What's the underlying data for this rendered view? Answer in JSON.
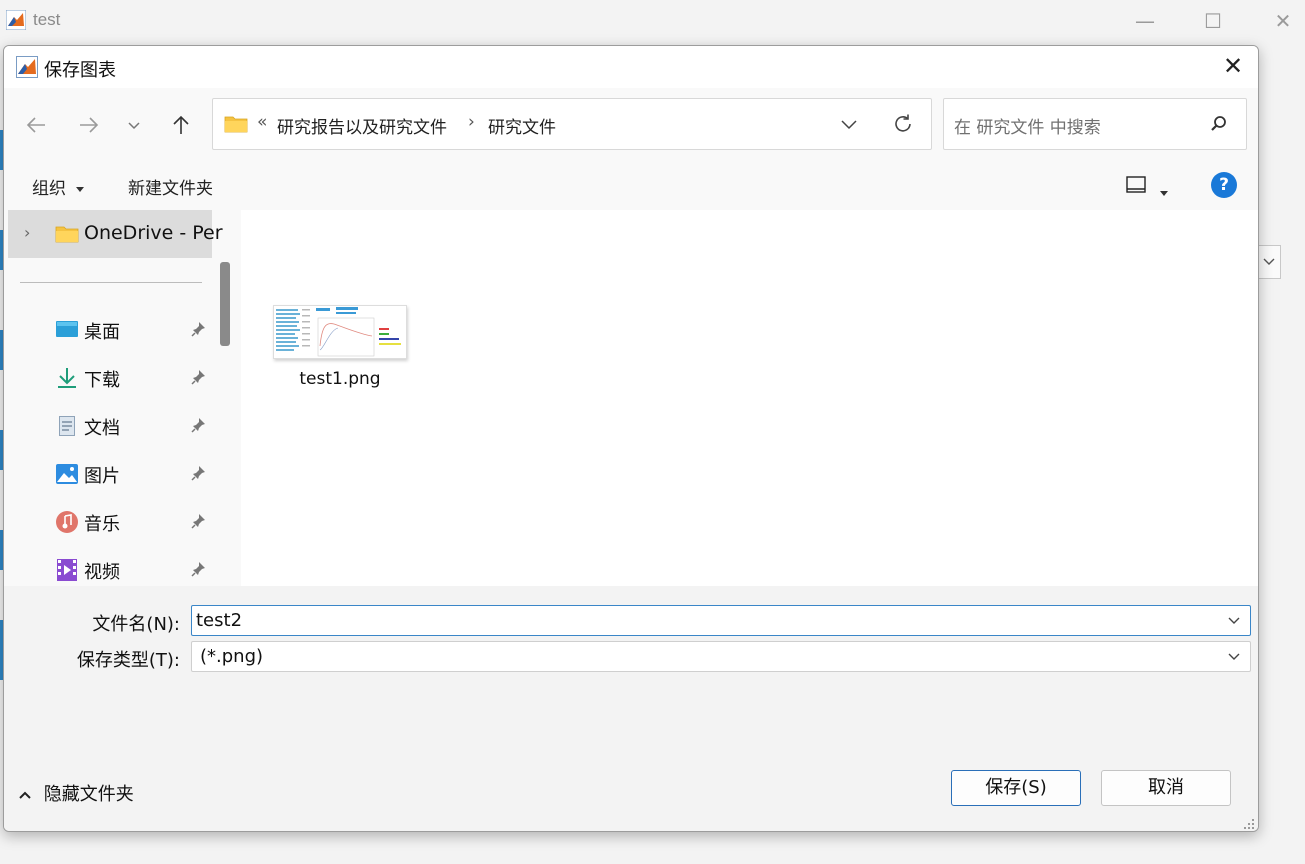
{
  "background_window": {
    "title": "test",
    "controls": {
      "minimize": "—",
      "maximize": "☐",
      "close": "✕"
    }
  },
  "dialog": {
    "title": "保存图表",
    "close": "✕"
  },
  "navigation": {
    "address": {
      "overflow": "«",
      "crumbs": [
        "研究报告以及研究文件",
        "研究文件"
      ],
      "separator": "›"
    },
    "search": {
      "placeholder": "在 研究文件 中搜索"
    }
  },
  "toolbar": {
    "organize_label": "组织",
    "new_folder_label": "新建文件夹",
    "help_label": "?"
  },
  "nav_pane": {
    "onedrive_label": "OneDrive - Per",
    "quick_access": [
      {
        "label": "桌面",
        "icon": "desktop-icon"
      },
      {
        "label": "下载",
        "icon": "download-icon"
      },
      {
        "label": "文档",
        "icon": "document-icon"
      },
      {
        "label": "图片",
        "icon": "pictures-icon"
      },
      {
        "label": "音乐",
        "icon": "music-icon"
      },
      {
        "label": "视频",
        "icon": "video-icon"
      }
    ]
  },
  "files": [
    {
      "name": "test1.png"
    }
  ],
  "form": {
    "filename_label": "文件名(N):",
    "filename_value": "test2",
    "filetype_label": "保存类型(T):",
    "filetype_value": "(*.png)"
  },
  "footer": {
    "hide_folders_label": "隐藏文件夹",
    "save_label": "保存(S)",
    "cancel_label": "取消"
  },
  "colors": {
    "accent": "#1f7ad1",
    "help_blue": "#1a79d8",
    "folder_yellow": "#f5c342",
    "primary_border": "#2a6fb8"
  }
}
